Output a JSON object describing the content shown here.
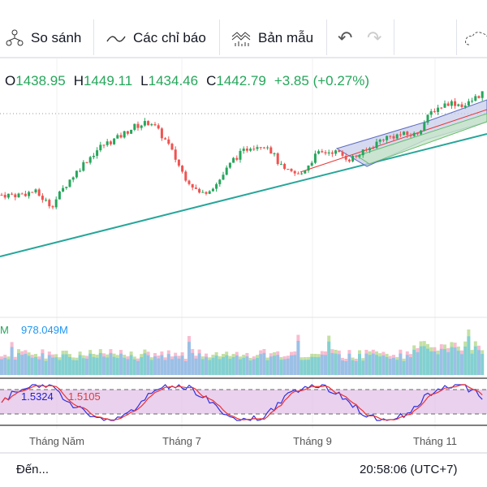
{
  "toolbar": {
    "compare": "So sánh",
    "indicators": "Các chỉ báo",
    "templates": "Bản mẫu"
  },
  "ohlc": {
    "o_label": "O",
    "o": "1438.95",
    "h_label": "H",
    "h": "1449.11",
    "l_label": "L",
    "l": "1434.46",
    "c_label": "C",
    "c": "1442.79",
    "change": "+3.85 (+0.27%)"
  },
  "volume": {
    "left_value": "M",
    "ma_value": "978.049M"
  },
  "stoch": {
    "k": "1.5324",
    "d": "1.5105"
  },
  "time_axis": [
    "Tháng Năm",
    "Tháng 7",
    "Tháng 9",
    "Tháng 11"
  ],
  "bottom": {
    "goto": "Đến...",
    "clock": "20:58:06 (UTC+7)"
  },
  "colors": {
    "up": "#26a65b",
    "down": "#ef5350",
    "trend": "#26a69a",
    "volume": "#5bc0de",
    "stoch_k": "#3030e0",
    "stoch_d": "#ef3030"
  },
  "chart_data": {
    "type": "candlestick",
    "price_path": [
      1393,
      1393,
      1395,
      1386,
      1401,
      1413,
      1423,
      1428,
      1435,
      1438,
      1425,
      1405,
      1393,
      1400,
      1415,
      1423,
      1424,
      1408,
      1405,
      1418,
      1420,
      1415,
      1420,
      1428,
      1430,
      1430,
      1445,
      1450,
      1448,
      1456
    ],
    "last_close": 1442.79
  }
}
